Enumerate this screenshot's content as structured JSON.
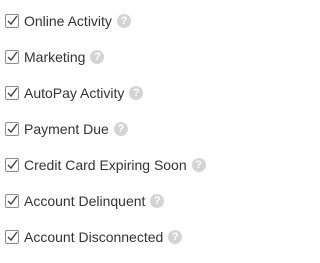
{
  "help_glyph": "?",
  "colors": {
    "label": "#333333",
    "checkbox_border": "#8c8c8c",
    "checkmark": "#444444",
    "help_icon_bg": "#d4d4d4"
  },
  "items": [
    {
      "label": "Online Activity",
      "checked": true
    },
    {
      "label": "Marketing",
      "checked": true
    },
    {
      "label": "AutoPay Activity",
      "checked": true
    },
    {
      "label": "Payment Due",
      "checked": true
    },
    {
      "label": "Credit Card Expiring Soon",
      "checked": true
    },
    {
      "label": "Account Delinquent",
      "checked": true
    },
    {
      "label": "Account Disconnected",
      "checked": true
    }
  ]
}
